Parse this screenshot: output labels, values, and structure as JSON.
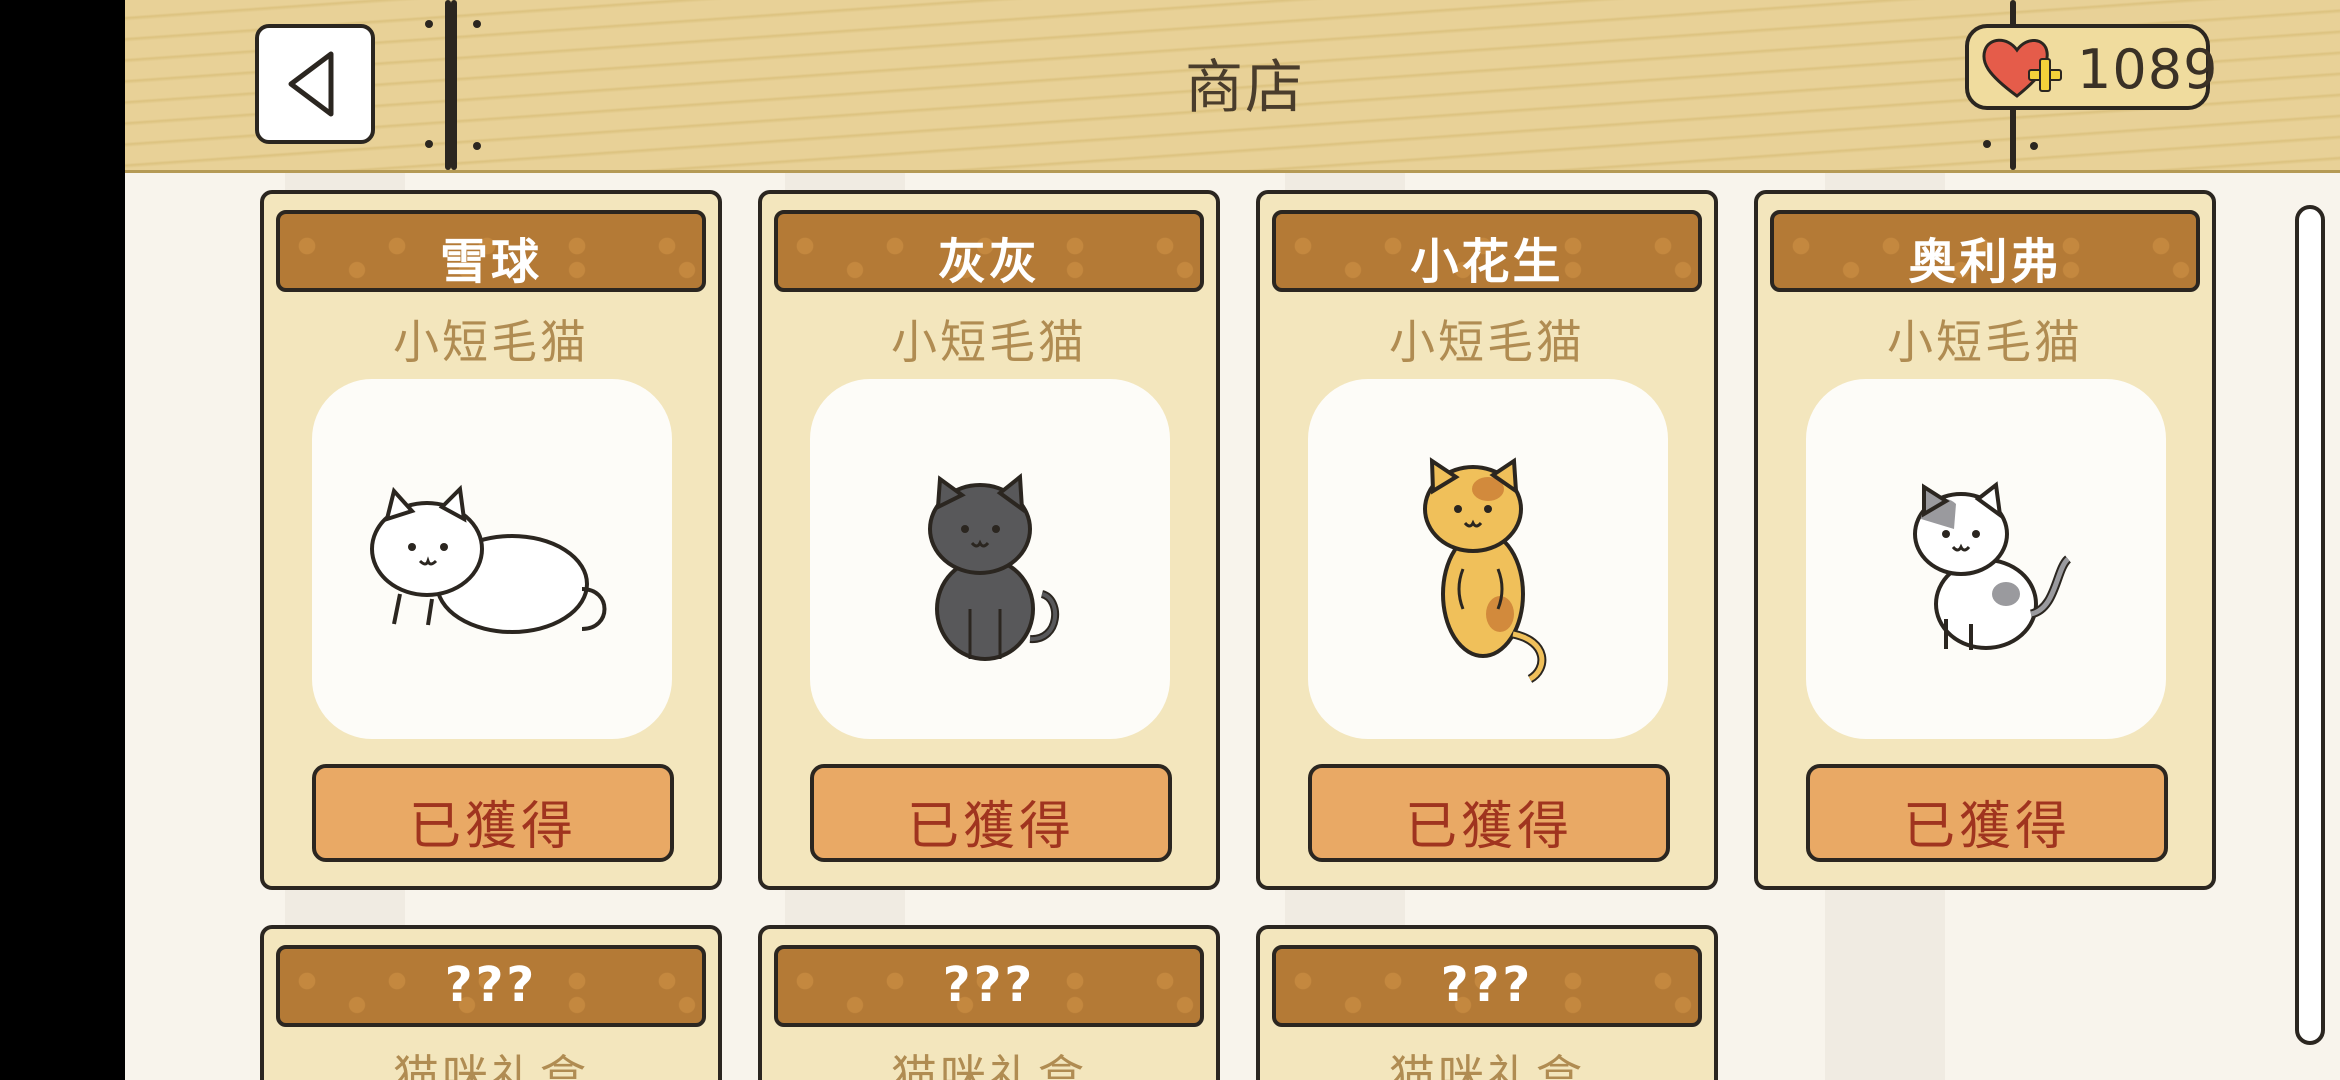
{
  "header": {
    "title": "商店",
    "currency_amount": "1089",
    "back_icon": "back-arrow-icon",
    "currency_icon": "heart-plus-icon"
  },
  "colors": {
    "wood": "#e8d197",
    "card": "#f3e6bd",
    "name_bar": "#b47a36",
    "owned_button": "#e9a965",
    "owned_text": "#a0341f"
  },
  "cats": [
    {
      "name": "雪球",
      "breed": "小短毛猫",
      "button": "已獲得",
      "icon": "white-cat-icon"
    },
    {
      "name": "灰灰",
      "breed": "小短毛猫",
      "button": "已獲得",
      "icon": "gray-cat-icon"
    },
    {
      "name": "小花生",
      "breed": "小短毛猫",
      "button": "已獲得",
      "icon": "calico-cat-icon"
    },
    {
      "name": "奥利弗",
      "breed": "小短毛猫",
      "button": "已獲得",
      "icon": "gray-white-cat-icon"
    }
  ],
  "mystery": [
    {
      "name": "???",
      "breed": "猫咪礼盒"
    },
    {
      "name": "???",
      "breed": "猫咪礼盒"
    },
    {
      "name": "???",
      "breed": "猫咪礼盒"
    }
  ]
}
